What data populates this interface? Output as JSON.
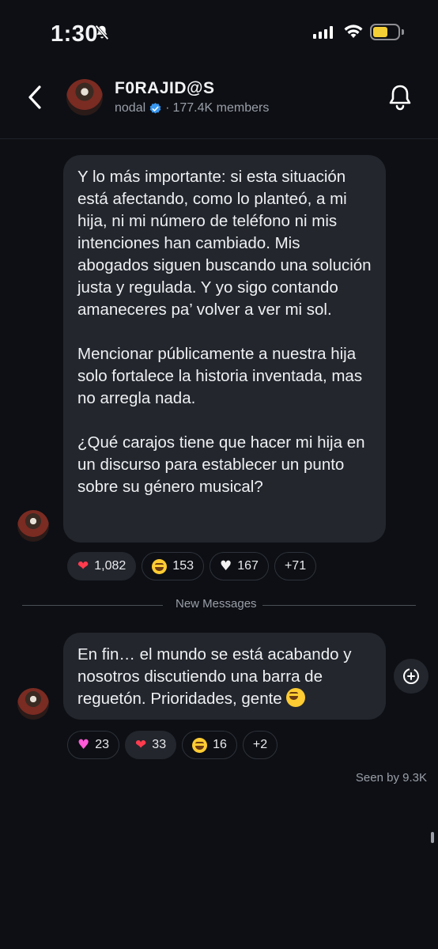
{
  "status_bar": {
    "time": "1:30",
    "battery_level": 0.6
  },
  "header": {
    "group_name": "F0RAJID@S",
    "owner": "nodal",
    "member_count": "177.4K members",
    "separator": "·"
  },
  "messages": [
    {
      "paragraphs": [
        "Y lo más importante: si esta situación está afectando, como lo planteó, a mi hija, ni mi número de teléfono ni mis intenciones han cambiado. Mis abogados siguen buscando una solución justa y regulada. Y yo sigo contando amaneceres pa’ volver a ver mi sol.",
        "Mencionar públicamente a nuestra hija solo fortalece la historia inventada, mas no arregla nada.",
        "¿Qué carajos tiene que hacer mi hija en un discurso para establecer un punto sobre su género musical?"
      ],
      "reactions": [
        {
          "emoji": "red-heart",
          "count": "1,082"
        },
        {
          "emoji": "tears-of-joy",
          "count": "153"
        },
        {
          "emoji": "white-heart",
          "count": "167"
        },
        {
          "emoji": "more",
          "count": "+71"
        }
      ]
    },
    {
      "paragraphs": [
        "En fin… el mundo se está acabando y nosotros discutiendo una barra de reguetón. Prioridades, gente"
      ],
      "reactions": [
        {
          "emoji": "pink-heart",
          "count": "23"
        },
        {
          "emoji": "red-heart",
          "count": "33"
        },
        {
          "emoji": "tears-of-joy",
          "count": "16"
        },
        {
          "emoji": "more",
          "count": "+2"
        }
      ]
    }
  ],
  "divider_label": "New Messages",
  "seen_by": "Seen by 9.3K"
}
